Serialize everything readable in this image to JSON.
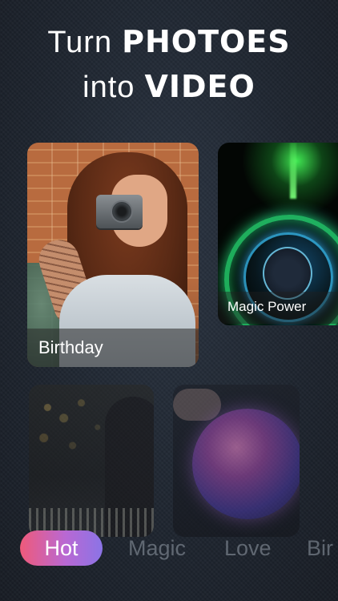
{
  "headline": {
    "line1_light": "Turn",
    "line1_bold": "PHOTOES",
    "line2_light": "into",
    "line2_bold": "VIDEO"
  },
  "cards": [
    {
      "label": "Birthday"
    },
    {
      "label": "Magic Power"
    }
  ],
  "categories": [
    "Hot",
    "Magic",
    "Love",
    "Bir"
  ],
  "colors": {
    "background": "#1e252f",
    "active_tab_gradient_start": "#ef5a7a",
    "active_tab_gradient_end": "#8b74e6"
  }
}
